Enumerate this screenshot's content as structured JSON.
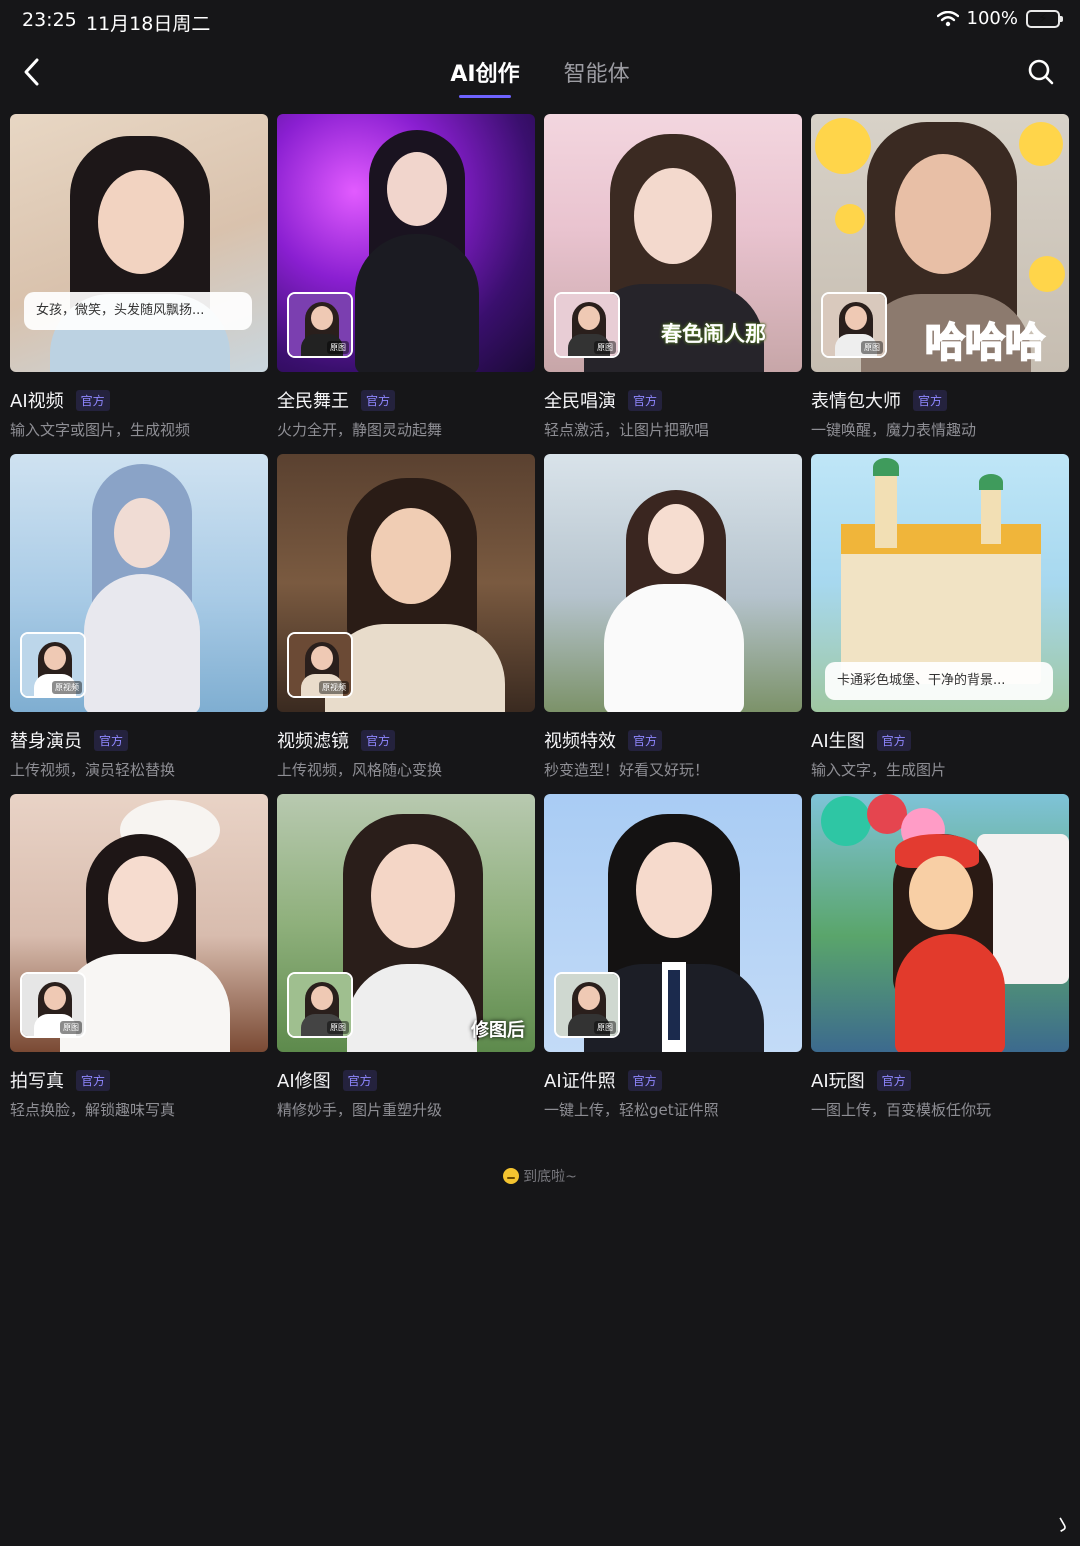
{
  "status_bar": {
    "time": "23:25",
    "date": "11月18日周二",
    "battery": "100%",
    "icons": [
      "wifi-icon",
      "battery-charging-icon"
    ]
  },
  "nav": {
    "back_icon": "chevron-left-icon",
    "tabs": [
      {
        "label": "AI创作",
        "active": true
      },
      {
        "label": "智能体",
        "active": false
      }
    ],
    "search_icon": "search-icon",
    "accent_color": "#6e63ff"
  },
  "official_label": "官方",
  "original_image_label": "原图",
  "original_video_label": "原视频",
  "cards": [
    {
      "title": "AI视频",
      "desc": "输入文字或图片，生成视频",
      "prompt": "女孩，微笑，头发随风飘扬..."
    },
    {
      "title": "全民舞王",
      "desc": "火力全开，静图灵动起舞"
    },
    {
      "title": "全民唱演",
      "desc": "轻点激活，让图片把歌唱",
      "overlay": "春色闹人那"
    },
    {
      "title": "表情包大师",
      "desc": "一键唤醒，魔力表情趣动",
      "overlay": "哈哈哈"
    },
    {
      "title": "替身演员",
      "desc": "上传视频，演员轻松替换"
    },
    {
      "title": "视频滤镜",
      "desc": "上传视频，风格随心变换"
    },
    {
      "title": "视频特效",
      "desc": "秒变造型！好看又好玩！"
    },
    {
      "title": "AI生图",
      "desc": "输入文字，生成图片",
      "prompt": "卡通彩色城堡、干净的背景..."
    },
    {
      "title": "拍写真",
      "desc": "轻点换脸，解锁趣味写真"
    },
    {
      "title": "AI修图",
      "desc": "精修妙手，图片重塑升级",
      "overlay": "修图后"
    },
    {
      "title": "AI证件照",
      "desc": "一键上传，轻松get证件照"
    },
    {
      "title": "AI玩图",
      "desc": "一图上传，百变模板任你玩"
    }
  ],
  "footer": {
    "end_text": "到底啦~",
    "emoji_icon": "smiling-face-icon"
  }
}
